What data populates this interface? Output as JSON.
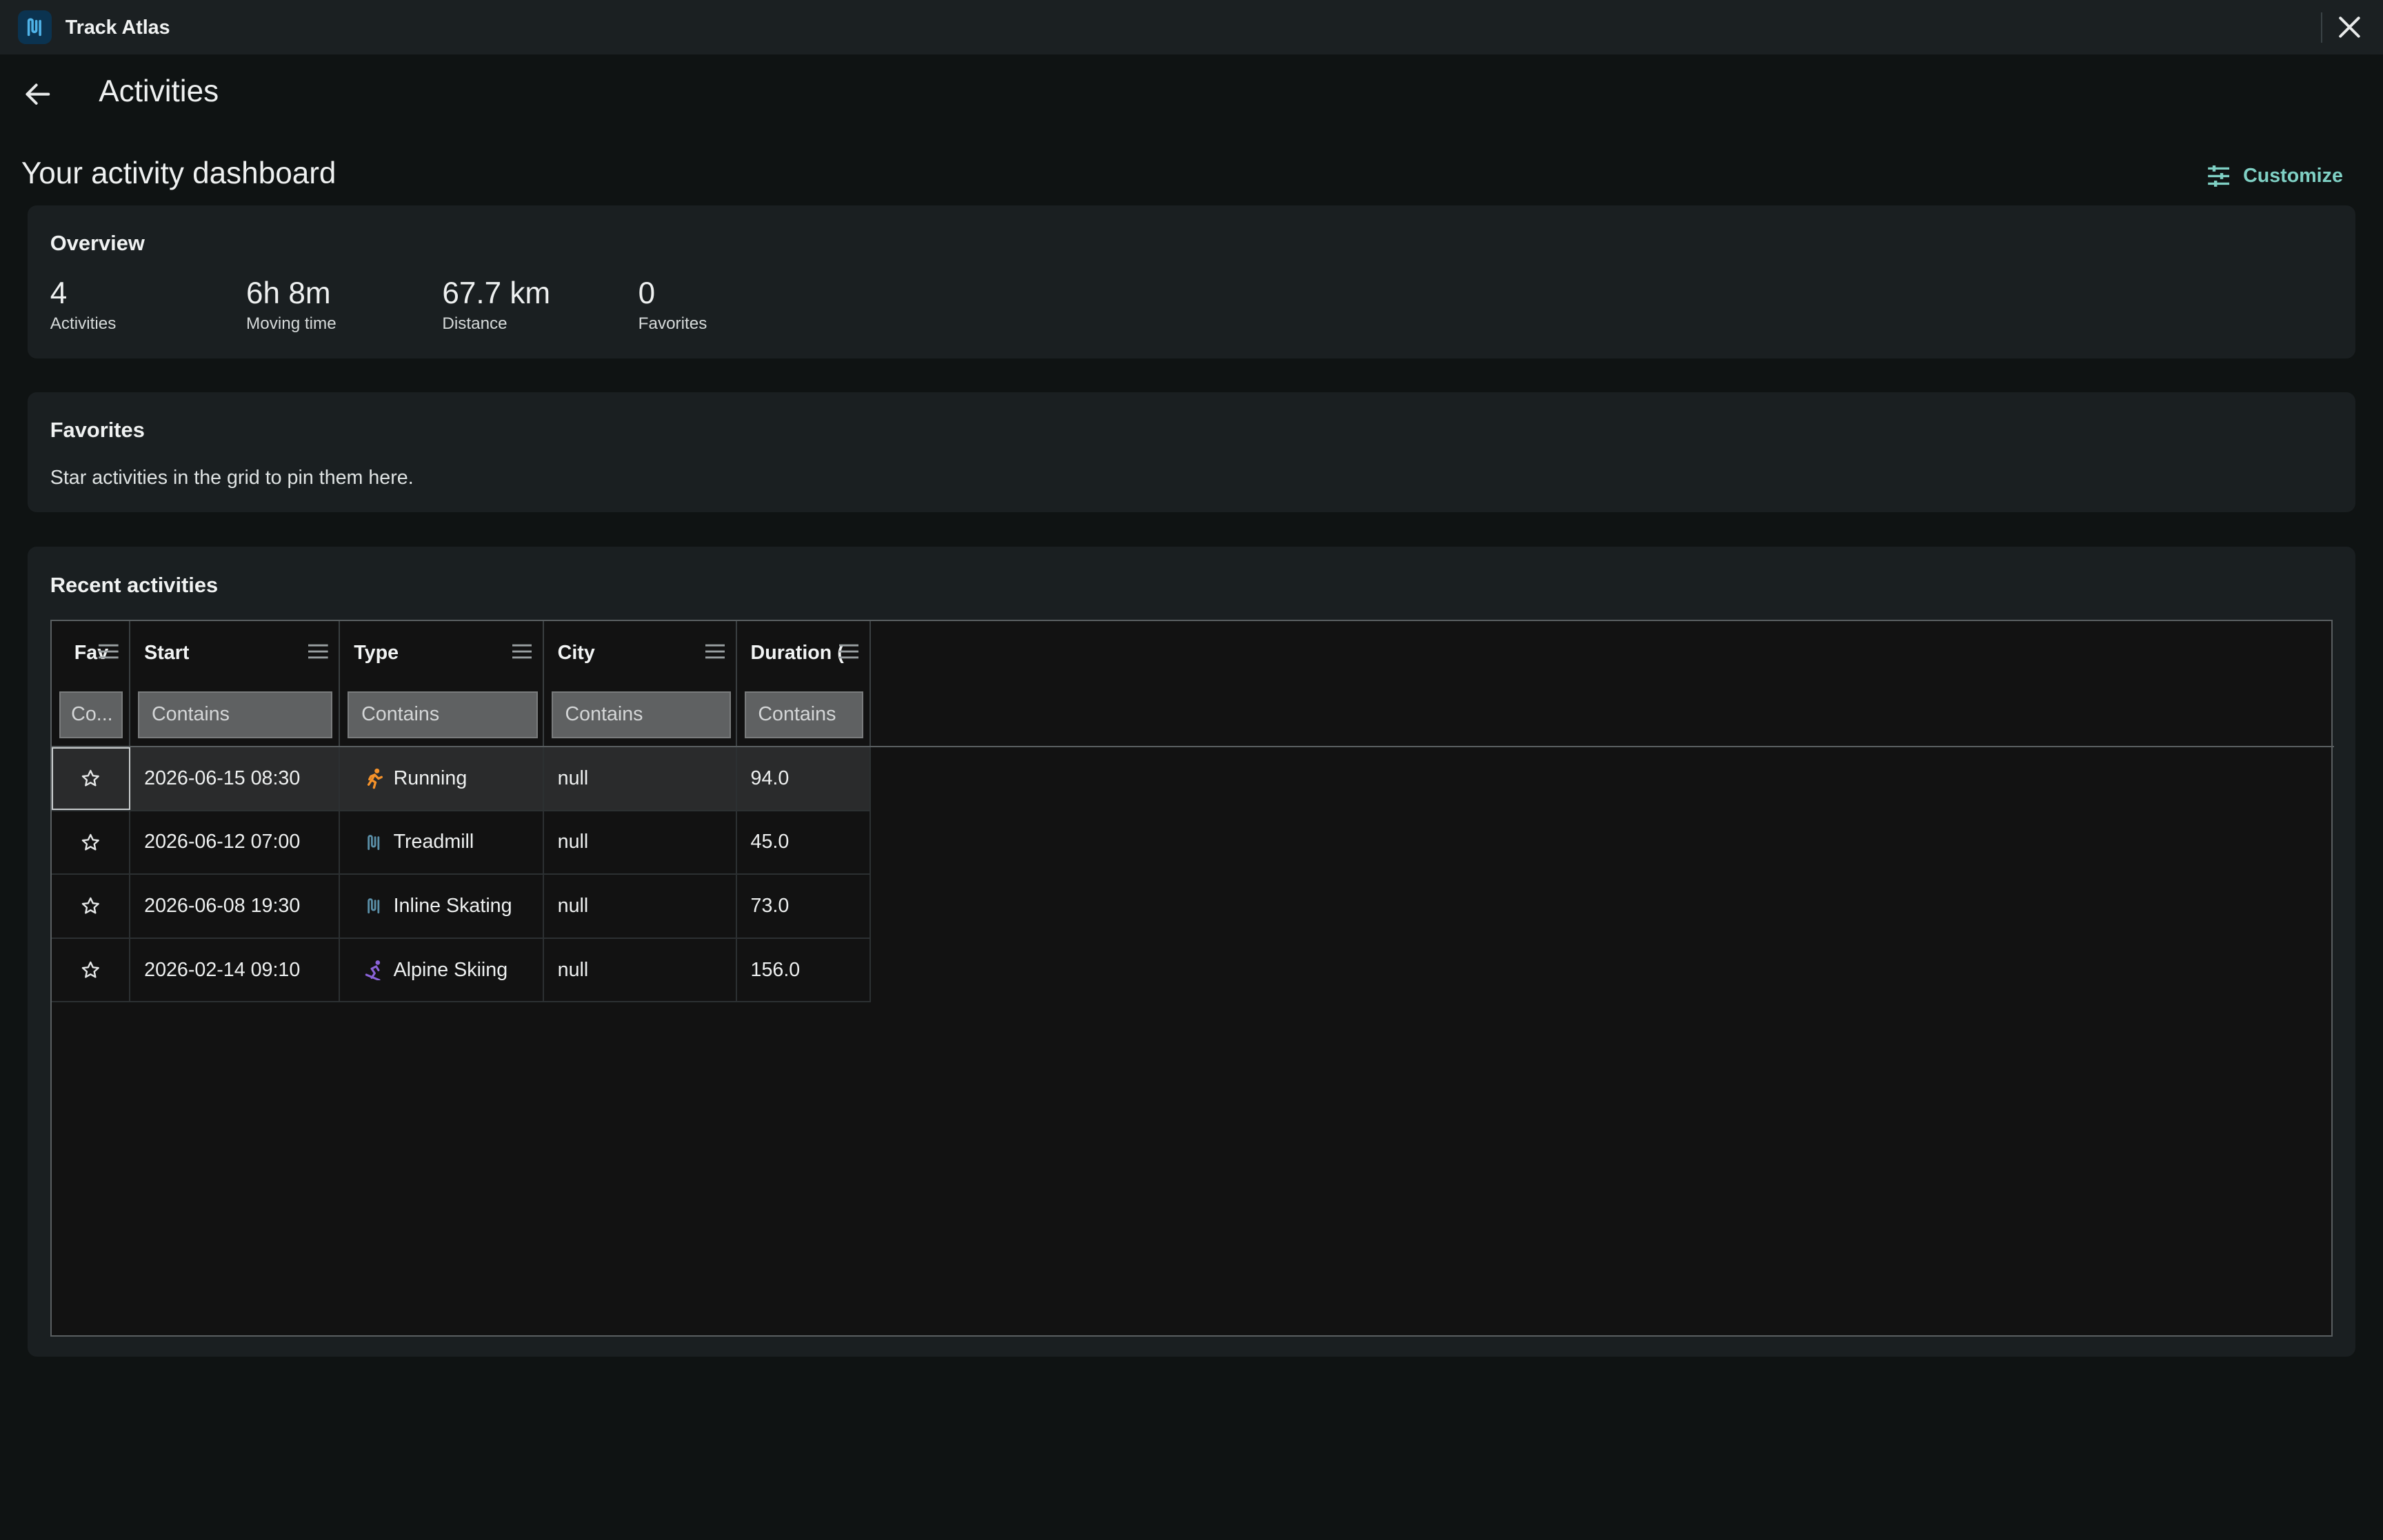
{
  "app": {
    "title": "Track Atlas"
  },
  "header": {
    "title": "Activities"
  },
  "dashboard": {
    "title": "Your activity dashboard",
    "customize_label": "Customize"
  },
  "overview": {
    "title": "Overview",
    "stats": [
      {
        "value": "4",
        "label": "Activities"
      },
      {
        "value": "6h 8m",
        "label": "Moving time"
      },
      {
        "value": "67.7 km",
        "label": "Distance"
      },
      {
        "value": "0",
        "label": "Favorites"
      }
    ]
  },
  "favorites": {
    "title": "Favorites",
    "empty_text": "Star activities in the grid to pin them here."
  },
  "recent": {
    "title": "Recent activities",
    "columns": [
      {
        "label": "Fav",
        "filter_placeholder": "Co..."
      },
      {
        "label": "Start",
        "filter_placeholder": "Contains"
      },
      {
        "label": "Type",
        "filter_placeholder": "Contains"
      },
      {
        "label": "City",
        "filter_placeholder": "Contains"
      },
      {
        "label": "Duration (",
        "filter_placeholder": "Contains"
      }
    ],
    "rows": [
      {
        "start": "2026-06-15 08:30",
        "type": "Running",
        "type_icon": "running-icon",
        "city": "null",
        "duration": "94.0"
      },
      {
        "start": "2026-06-12 07:00",
        "type": "Treadmill",
        "type_icon": "generic-activity-icon",
        "city": "null",
        "duration": "45.0"
      },
      {
        "start": "2026-06-08 19:30",
        "type": "Inline Skating",
        "type_icon": "generic-activity-icon",
        "city": "null",
        "duration": "73.0"
      },
      {
        "start": "2026-02-14 09:10",
        "type": "Alpine Skiing",
        "type_icon": "skiing-icon",
        "city": "null",
        "duration": "156.0"
      }
    ]
  },
  "colors": {
    "accent": "#7fd0c4",
    "running": "#f5922a",
    "skiing": "#8b63d9",
    "generic": "#5a8fa8",
    "background": "#0f1313",
    "card": "#1a1f21"
  }
}
